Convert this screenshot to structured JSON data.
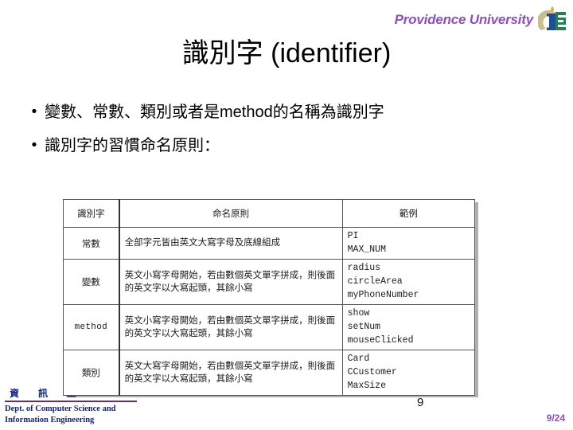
{
  "header": {
    "brand": "Providence University",
    "logo_name": "providence-cie-logo",
    "logo_colors": {
      "crescent": "#c9be92",
      "letter_i": "#1b4f9c",
      "flame": "#e8a33d",
      "letter_e": "#2e7d52"
    }
  },
  "title": "識別字 (identifier)",
  "bullets": [
    {
      "marker": "•",
      "text": "變數、常數、類別或者是method的名稱為識別字"
    },
    {
      "marker": "•",
      "text": "識別字的習慣命名原則："
    }
  ],
  "table": {
    "headers": [
      "識別字",
      "命名原則",
      "範例"
    ],
    "rows": [
      {
        "kind": "常數",
        "kind_mono": false,
        "rule": "全部字元皆由英文大寫字母及底線組成",
        "examples": [
          "PI",
          "MAX_NUM"
        ]
      },
      {
        "kind": "變數",
        "kind_mono": false,
        "rule": "英文小寫字母開始，若由數個英文單字拼成，則後面的英文字以大寫起頭，其餘小寫",
        "examples": [
          "radius",
          "circleArea",
          "myPhoneNumber"
        ]
      },
      {
        "kind": "method",
        "kind_mono": true,
        "rule": "英文小寫字母開始，若由數個英文單字拼成，則後面的英文字以大寫起頭，其餘小寫",
        "examples": [
          "show",
          "setNum",
          "mouseClicked"
        ]
      },
      {
        "kind": "類別",
        "kind_mono": false,
        "rule": "英文大寫字母開始，若由數個英文單字拼成，則後面的英文字以大寫起頭，其餘小寫",
        "examples": [
          "Card",
          "CCustomer",
          "MaxSize"
        ]
      }
    ]
  },
  "mid_number": "9",
  "footer": {
    "cjk": [
      "資",
      "訊",
      "工"
    ],
    "line1": "Dept. of Computer Science and",
    "line2": "Information Engineering"
  },
  "page_indicator": "9/24",
  "accents": {
    "brand_purple": "#8e4fc0",
    "footer_navy": "#13238c",
    "footer_rule": "#6e2a6e"
  }
}
